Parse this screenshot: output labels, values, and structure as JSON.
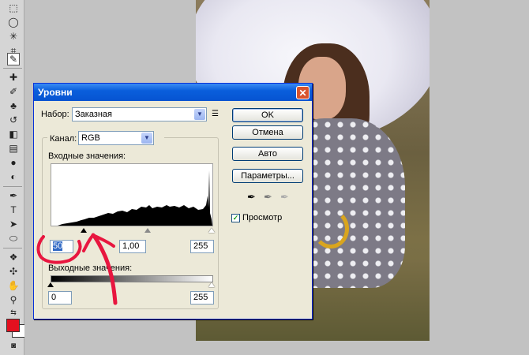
{
  "dialog": {
    "title": "Уровни",
    "close_glyph": "✕",
    "preset_label": "Набор:",
    "preset_value": "Заказная",
    "channel_label": "Канал:",
    "channel_value": "RGB",
    "input_label": "Входные значения:",
    "output_label": "Выходные значения:",
    "input_black": "50",
    "input_gamma": "1,00",
    "input_white": "255",
    "output_black": "0",
    "output_white": "255",
    "buttons": {
      "ok": "OK",
      "cancel": "Отмена",
      "auto": "Авто",
      "options": "Параметры..."
    },
    "preview_label": "Просмотр",
    "preview_checked": true
  },
  "toolbar": {
    "foreground_color": "#e3101f",
    "background_color": "#ffffff",
    "tools": [
      "marquee-icon",
      "lasso-icon",
      "magic-wand-icon",
      "crop-icon",
      "eyedropper-icon",
      "healing-brush-icon",
      "brush-icon",
      "stamp-icon",
      "history-brush-icon",
      "eraser-icon",
      "gradient-icon",
      "blur-icon",
      "dodge-icon",
      "pen-icon",
      "type-icon",
      "path-select-icon",
      "shape-icon",
      "3d-rotate-icon",
      "3d-orbit-icon",
      "hand-icon",
      "zoom-icon"
    ]
  },
  "colors": {
    "titlebar": "#0a5fdc",
    "dialog_bg": "#ece9d8",
    "annotation": "#e8163f",
    "selection": "#316ac5"
  }
}
